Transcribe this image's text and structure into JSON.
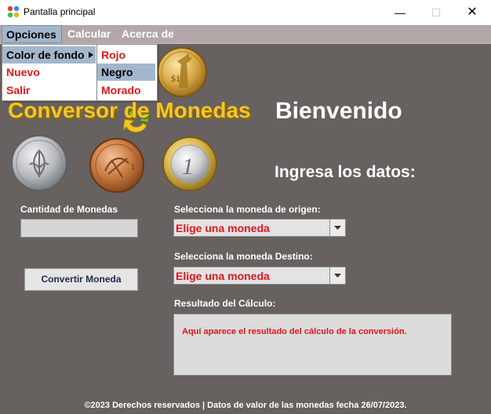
{
  "window": {
    "title": "Pantalla principal",
    "minimize_glyph": "—",
    "maximize_glyph": "☐",
    "close_glyph": "✕"
  },
  "menubar": {
    "items": [
      {
        "label": "Opciones",
        "active": true
      },
      {
        "label": "Calcular"
      },
      {
        "label": "Acerca de"
      }
    ]
  },
  "options_menu": {
    "items": [
      {
        "label": "Color de fondo",
        "has_submenu": true,
        "color": "#000000"
      },
      {
        "label": "Nuevo",
        "color": "#e0171c"
      },
      {
        "label": "Salir",
        "color": "#e0171c"
      }
    ]
  },
  "color_submenu": {
    "items": [
      {
        "label": "Rojo",
        "color": "#e0171c"
      },
      {
        "label": "Negro",
        "color": "#000000",
        "highlighted": true
      },
      {
        "label": "Morado",
        "color": "#e0171c"
      }
    ]
  },
  "logo_text": "Conversor de Monedas",
  "welcome": "Bienvenido",
  "prompt": "Ingresa los datos:",
  "form": {
    "amount_label": "Cantidad de Monedas",
    "amount_value": "",
    "convert_button": "Convertir Moneda",
    "origin_label": "Selecciona la moneda de origen:",
    "origin_value": "Elige una moneda",
    "dest_label": "Selecciona la moneda Destino:",
    "dest_value": "Elige una moneda",
    "result_label": "Resultado del Cálculo:",
    "result_text": "Aquí aparece el resultado del cálculo de la conversión."
  },
  "footer": "©2023 Derechos reservados | Datos de valor de las monedas fecha 26/07/2023.",
  "colors": {
    "background": "#676160",
    "menubar": "#b3a7a8",
    "accent_red": "#e0171c",
    "logo_yellow": "#f7c525",
    "menu_highlight": "#a3b7cc"
  },
  "icons": [
    "app-icon",
    "coin-liberty-icon",
    "coin-yen-icon",
    "coin-copper-icon",
    "coin-euro-icon",
    "exchange-arrow-icon",
    "chevron-down-icon",
    "submenu-arrow-icon"
  ]
}
